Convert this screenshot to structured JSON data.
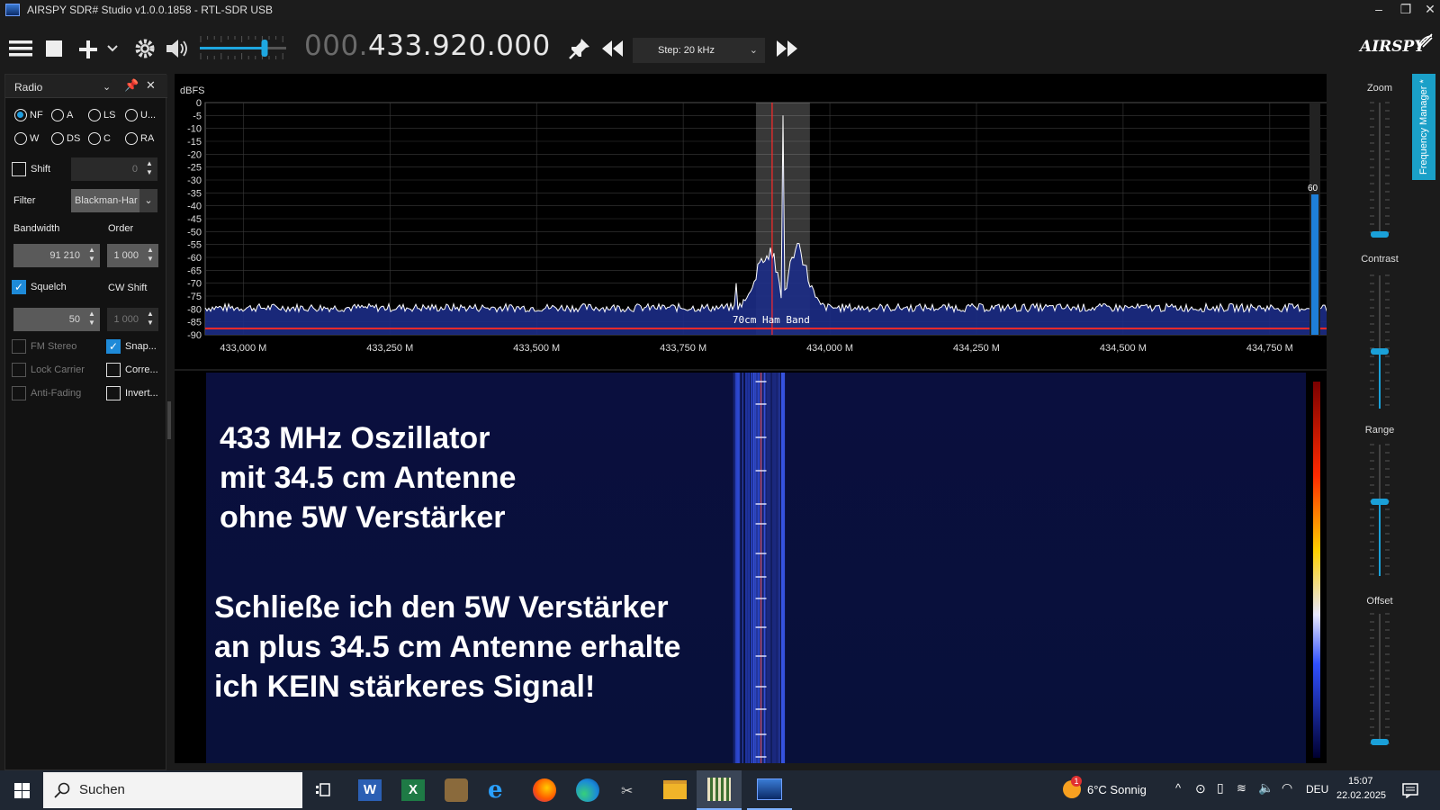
{
  "window": {
    "title": "AIRSPY SDR# Studio v1.0.0.1858 - RTL-SDR USB",
    "controls": [
      "minimize-icon",
      "restore-icon",
      "close-icon"
    ]
  },
  "toolbar": {
    "frequency_dim": "000.",
    "frequency_main": "433.920.000",
    "step_label": "Step: 20 kHz",
    "logo": "AIRSPY",
    "volume_level": 0.75,
    "icons": [
      "menu-icon",
      "stop-icon",
      "add-icon",
      "settings-icon",
      "speaker-icon",
      "pin-icon",
      "rewind-icon",
      "fast-forward-icon"
    ]
  },
  "radio_panel": {
    "title": "Radio",
    "modes_row1": [
      "NF",
      "A",
      "LS",
      "U..."
    ],
    "modes_row2": [
      "W",
      "DS",
      "C",
      "RA"
    ],
    "selected_mode": "NF",
    "shift_label": "Shift",
    "shift_value": "0",
    "filter_label": "Filter",
    "filter_value": "Blackman-Har",
    "bandwidth_label": "Bandwidth",
    "bandwidth_value": "91 210",
    "order_label": "Order",
    "order_value": "1 000",
    "squelch_label": "Squelch",
    "squelch_value": "50",
    "cw_shift_label": "CW Shift",
    "cw_shift_value": "1 000",
    "fm_stereo": "FM Stereo",
    "snap": "Snap...",
    "lock_carrier": "Lock Carrier",
    "correct": "Corre...",
    "anti_fading": "Anti-Fading",
    "invert": "Invert..."
  },
  "spectrum": {
    "unit": "dBFS",
    "band_label": "70cm Ham Band",
    "peak_label": "60",
    "y_ticks": [
      "0",
      "-5",
      "-10",
      "-15",
      "-20",
      "-25",
      "-30",
      "-35",
      "-40",
      "-45",
      "-50",
      "-55",
      "-60",
      "-65",
      "-70",
      "-75",
      "-80",
      "-85",
      "-90"
    ],
    "x_ticks": [
      "433,000 M",
      "433,250 M",
      "433,500 M",
      "433,750 M",
      "434,000 M",
      "434,250 M",
      "434,500 M",
      "434,750 M"
    ],
    "colors": {
      "trace": "#ffffff",
      "fill": "#1a2a80",
      "marker": "#ff3030",
      "grid": "#3a3a3a"
    }
  },
  "overlay_text": {
    "line1": "433 MHz Oszillator",
    "line2": "mit 34.5 cm Antenne",
    "line3": "ohne 5W Verstärker",
    "line4": "Schließe ich den 5W Verstärker",
    "line5": "an plus 34.5 cm Antenne erhalte",
    "line6": "ich KEIN stärkeres Signal!"
  },
  "right_panel": {
    "zoom": "Zoom",
    "contrast": "Contrast",
    "range": "Range",
    "offset": "Offset",
    "frequency_manager": "Frequency Manager *"
  },
  "taskbar": {
    "search_placeholder": "Suchen",
    "weather": "6°C  Sonnig",
    "language": "DEU",
    "time": "15:07",
    "date": "22.02.2025",
    "notification_badge": "1"
  }
}
